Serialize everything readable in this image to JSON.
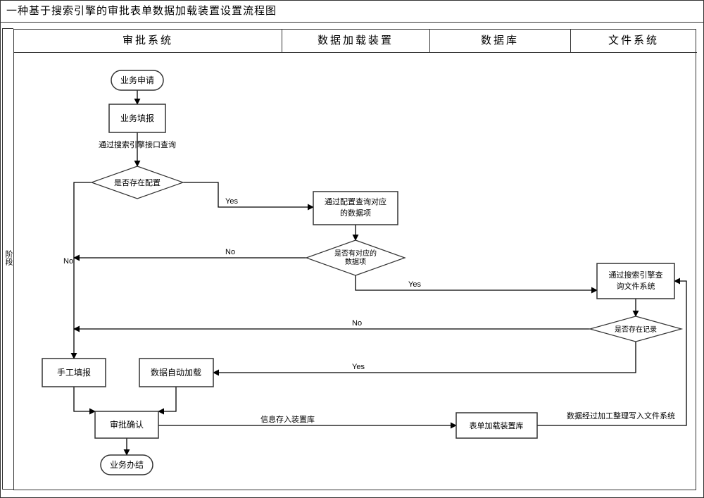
{
  "title": "一种基于搜索引擎的审批表单数据加载装置设置流程图",
  "phase_label": "阶段",
  "lanes": {
    "l1": "审批系统",
    "l2": "数据加载装置",
    "l3": "数据库",
    "l4": "文件系统"
  },
  "nodes": {
    "start": "业务申请",
    "fill": "业务填报",
    "q_conf": "是否存在配置",
    "lookup": "通过配置查询对应的数据项",
    "lookup_l1": "通过配置查询对应",
    "lookup_l2": "的数据项",
    "q_item": "是否有对应的数据项",
    "q_item_l1": "是否有对应的",
    "q_item_l2": "数据项",
    "fs_query": "通过搜索引擎查询文件系统",
    "fs_query_l1": "通过搜索引擎查",
    "fs_query_l2": "询文件系统",
    "q_rec": "是否存在记录",
    "manual": "手工填报",
    "auto": "数据自动加载",
    "confirm": "审批确认",
    "db": "表单加载装置库",
    "end": "业务办结"
  },
  "edges": {
    "e_query": "通过搜索引擎接口查询",
    "e_save": "信息存入装置库",
    "e_write": "数据经过加工整理写入文件系统",
    "yes": "Yes",
    "no": "No"
  },
  "chart_data": {
    "type": "flowchart_swimlane",
    "title": "一种基于搜索引擎的审批表单数据加载装置设置流程图",
    "lanes": [
      "审批系统",
      "数据加载装置",
      "数据库",
      "文件系统"
    ],
    "phases": [
      "阶段"
    ],
    "nodes": [
      {
        "id": "start",
        "lane": "审批系统",
        "type": "terminator",
        "label": "业务申请"
      },
      {
        "id": "fill",
        "lane": "审批系统",
        "type": "process",
        "label": "业务填报"
      },
      {
        "id": "q_conf",
        "lane": "审批系统",
        "type": "decision",
        "label": "是否存在配置"
      },
      {
        "id": "lookup",
        "lane": "数据加载装置",
        "type": "process",
        "label": "通过配置查询对应的数据项"
      },
      {
        "id": "q_item",
        "lane": "数据加载装置",
        "type": "decision",
        "label": "是否有对应的数据项"
      },
      {
        "id": "fs_query",
        "lane": "文件系统",
        "type": "process",
        "label": "通过搜索引擎查询文件系统"
      },
      {
        "id": "q_rec",
        "lane": "文件系统",
        "type": "decision",
        "label": "是否存在记录"
      },
      {
        "id": "manual",
        "lane": "审批系统",
        "type": "process",
        "label": "手工填报"
      },
      {
        "id": "auto",
        "lane": "审批系统",
        "type": "process",
        "label": "数据自动加载"
      },
      {
        "id": "confirm",
        "lane": "审批系统",
        "type": "process",
        "label": "审批确认"
      },
      {
        "id": "db",
        "lane": "数据库",
        "type": "process",
        "label": "表单加载装置库"
      },
      {
        "id": "end",
        "lane": "审批系统",
        "type": "terminator",
        "label": "业务办结"
      }
    ],
    "edges": [
      {
        "from": "start",
        "to": "fill"
      },
      {
        "from": "fill",
        "to": "q_conf",
        "label": "通过搜索引擎接口查询"
      },
      {
        "from": "q_conf",
        "to": "lookup",
        "label": "Yes"
      },
      {
        "from": "q_conf",
        "to": "manual",
        "label": "No"
      },
      {
        "from": "lookup",
        "to": "q_item"
      },
      {
        "from": "q_item",
        "to": "manual",
        "label": "No"
      },
      {
        "from": "q_item",
        "to": "fs_query",
        "label": "Yes"
      },
      {
        "from": "fs_query",
        "to": "q_rec"
      },
      {
        "from": "q_rec",
        "to": "manual",
        "label": "No"
      },
      {
        "from": "q_rec",
        "to": "auto",
        "label": "Yes"
      },
      {
        "from": "manual",
        "to": "confirm"
      },
      {
        "from": "auto",
        "to": "confirm"
      },
      {
        "from": "confirm",
        "to": "db",
        "label": "信息存入装置库"
      },
      {
        "from": "confirm",
        "to": "end"
      },
      {
        "from": "db",
        "to": "fs_query",
        "label": "数据经过加工整理写入文件系统"
      }
    ]
  }
}
